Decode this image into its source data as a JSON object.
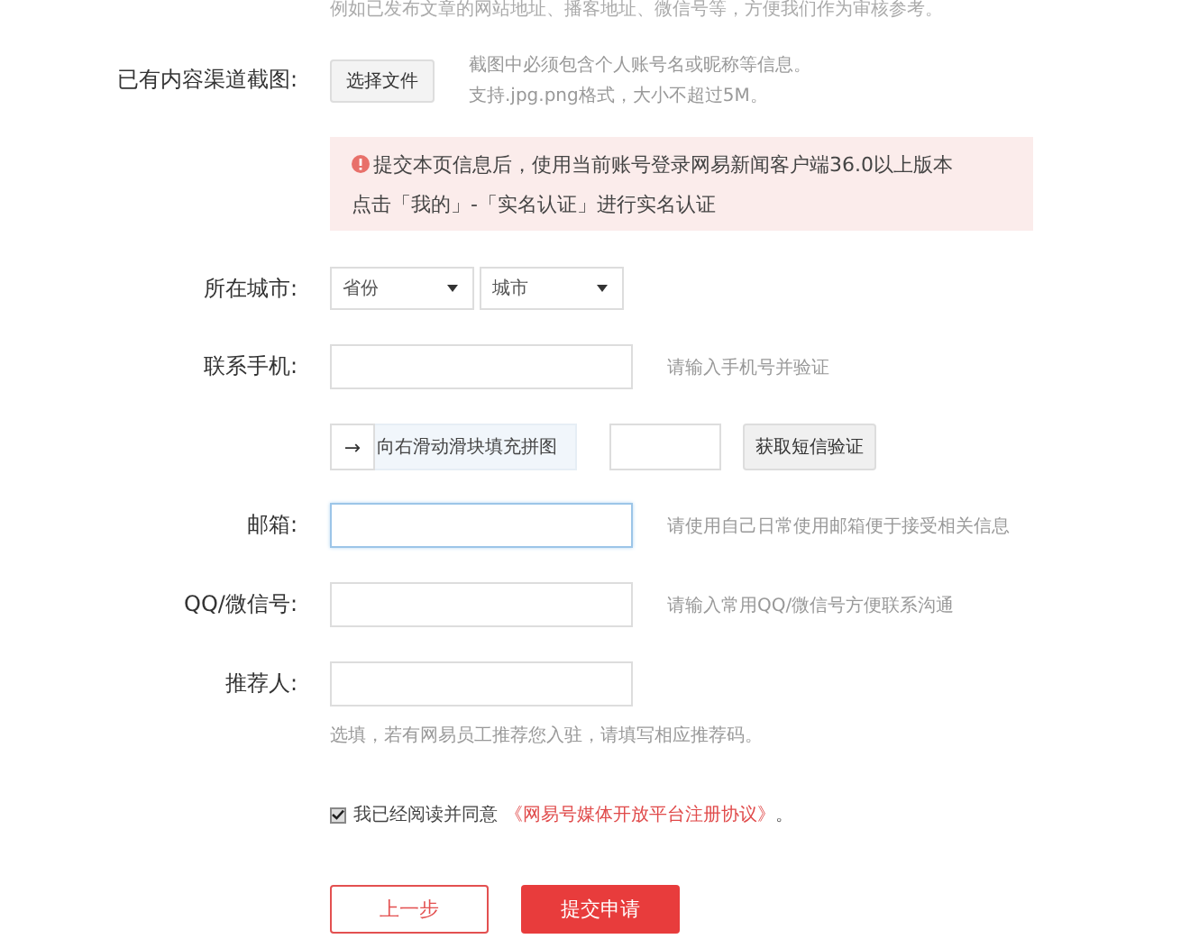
{
  "top_note": "例如已发布文章的网站地址、播客地址、微信号等，方便我们作为审核参考。",
  "upload": {
    "label": "已有内容渠道截图:",
    "button": "选择文件",
    "hints": [
      "截图中必须包含个人账号名或昵称等信息。",
      "支持.jpg.png格式，大小不超过5M。"
    ]
  },
  "notice": {
    "lines": [
      "提交本页信息后，使用当前账号登录网易新闻客户端36.0以上版本",
      "点击「我的」-「实名认证」进行实名认证"
    ]
  },
  "city": {
    "label": "所在城市:",
    "selects": [
      {
        "value": "省份"
      },
      {
        "value": "城市"
      }
    ]
  },
  "phone": {
    "label": "联系手机:",
    "hint": "请输入手机号并验证",
    "slider": {
      "arrow": "→",
      "text": "向右滑动滑块填充拼图"
    },
    "sms_button": "获取短信验证"
  },
  "fields": [
    {
      "label": "邮箱:",
      "hint": "请使用自己日常使用邮箱便于接受相关信息",
      "focused": true
    },
    {
      "label": "QQ/微信号:",
      "hint": "请输入常用QQ/微信号方便联系沟通",
      "focused": false
    },
    {
      "label": "推荐人:",
      "focused": false,
      "note": "选填，若有网易员工推荐您入驻，请填写相应推荐码。"
    }
  ],
  "agreement": {
    "checked": true,
    "text": "我已经阅读并同意",
    "link": "《网易号媒体开放平台注册协议》",
    "end": "。"
  },
  "buttons": {
    "back": "上一步",
    "submit": "提交申请"
  }
}
